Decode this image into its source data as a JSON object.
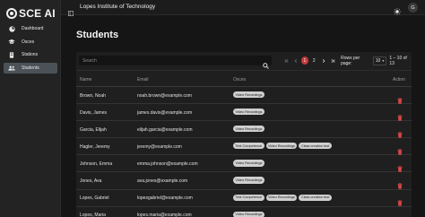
{
  "brand": {
    "name": "SCE AI"
  },
  "sidebar": {
    "items": [
      {
        "label": "Dashboard",
        "icon": "dashboard-icon",
        "active": false
      },
      {
        "label": "Osces",
        "icon": "graduation-cap-icon",
        "active": false
      },
      {
        "label": "Stations",
        "icon": "station-icon",
        "active": false
      },
      {
        "label": "Students",
        "icon": "people-icon",
        "active": true
      }
    ]
  },
  "header": {
    "institute": "Lopes Institute of Technology",
    "avatar_initial": "G"
  },
  "page": {
    "title": "Students"
  },
  "search": {
    "placeholder": "Search"
  },
  "pagination": {
    "pages": [
      "1",
      "2"
    ],
    "current_page": "1",
    "rows_label": "Rows per page:",
    "rows_value": "10",
    "range": "1 – 10 of 13"
  },
  "table": {
    "headers": {
      "name": "Name",
      "email": "Email",
      "osces": "Osces",
      "action": "Action"
    },
    "rows": [
      {
        "name": "Brown, Noah",
        "email": "noah.brown@example.com",
        "osces": [
          "Video Recordings"
        ]
      },
      {
        "name": "Davis, James",
        "email": "james.davis@example.com",
        "osces": [
          "Video Recordings"
        ]
      },
      {
        "name": "Garcia, Elijah",
        "email": "elijah.garcia@example.com",
        "osces": [
          "Video Recordings"
        ]
      },
      {
        "name": "Hagler, Jeremy",
        "email": "jeremy@example.com",
        "osces": [
          "Test Competence",
          "Video Recordings",
          "Class creation test"
        ]
      },
      {
        "name": "Johnson, Emma",
        "email": "emma.johnson@example.com",
        "osces": [
          "Video Recordings"
        ]
      },
      {
        "name": "Jones, Ava",
        "email": "ava.jones@example.com",
        "osces": [
          "Video Recordings"
        ]
      },
      {
        "name": "Lopes, Gabriel",
        "email": "lopesgabriel@example.com",
        "osces": [
          "Test Competence",
          "Video Recordings",
          "Class creation test"
        ]
      },
      {
        "name": "Lopes, Maria",
        "email": "lopes.maria@example.com",
        "osces": [
          "Video Recordings"
        ]
      }
    ]
  },
  "colors": {
    "accent": "#c33a3a",
    "delete": "#d64545",
    "active_nav": "#4b5257"
  }
}
